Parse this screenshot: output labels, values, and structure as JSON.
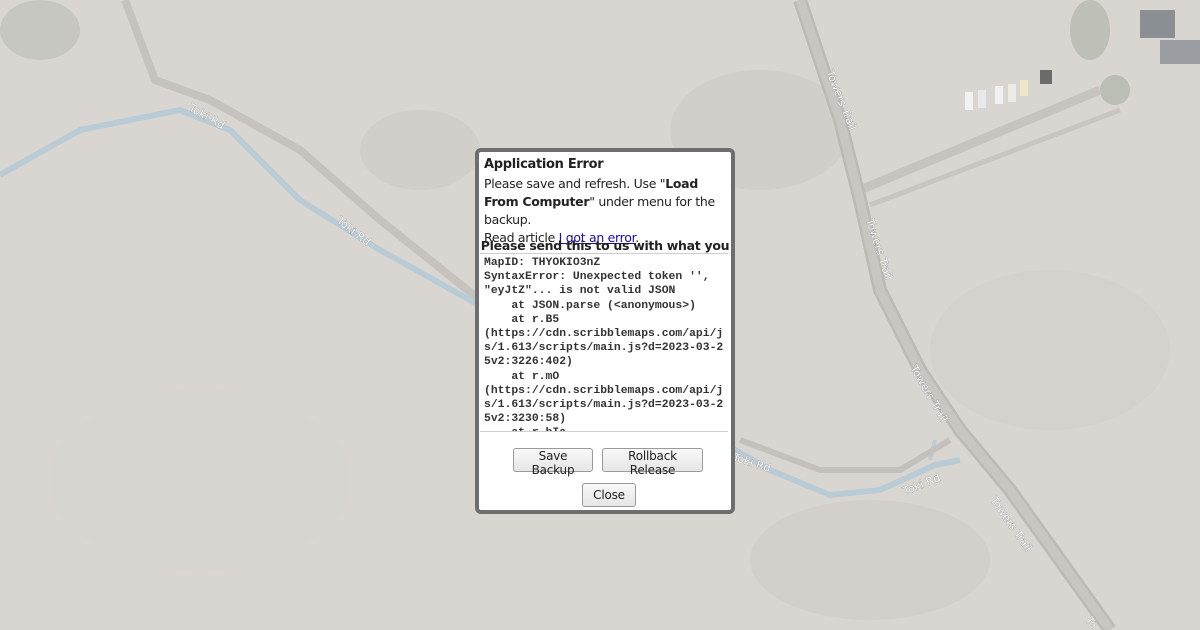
{
  "map": {
    "road_labels": [
      {
        "id": "toki-rd-1",
        "text": "Toki Rd"
      },
      {
        "id": "toki-rd-2",
        "text": "Toki Rd"
      },
      {
        "id": "toki-rd-3",
        "text": "Toki Rd"
      },
      {
        "id": "toki-rd-4",
        "text": "Toki Rd"
      },
      {
        "id": "towers-trail-1",
        "text": "Towers Trail"
      },
      {
        "id": "towers-trail-2",
        "text": "Towers Trail"
      },
      {
        "id": "towers-trail-3",
        "text": "Towers Trail"
      },
      {
        "id": "towers-trail-4",
        "text": "Towers Trail"
      },
      {
        "id": "towers-trail-5",
        "text": "To"
      }
    ]
  },
  "dialog": {
    "title": "Application Error",
    "message_pre": "Please save and refresh. Use \"",
    "message_bold": "Load From Computer",
    "message_post": "\" under menu for the backup.",
    "read_prefix": "Read article ",
    "read_link": "I got an error",
    "read_suffix": ".",
    "send_text": "Please send this to us with what you",
    "error_log": "MapID: THYOKIO3nZ\nSyntaxError: Unexpected token '', \"eyJtZ\"... is not valid JSON\n    at JSON.parse (<anonymous>)\n    at r.B5\n(https://cdn.scribblemaps.com/api/js/1.613/scripts/main.js?d=2023-03-25v2:3226:402)\n    at r.mO\n(https://cdn.scribblemaps.com/api/js/1.613/scripts/main.js?d=2023-03-25v2:3230:58)\n    at r.bIa",
    "save_label": "Save Backup",
    "rollback_label": "Rollback Release",
    "close_label": "Close"
  }
}
